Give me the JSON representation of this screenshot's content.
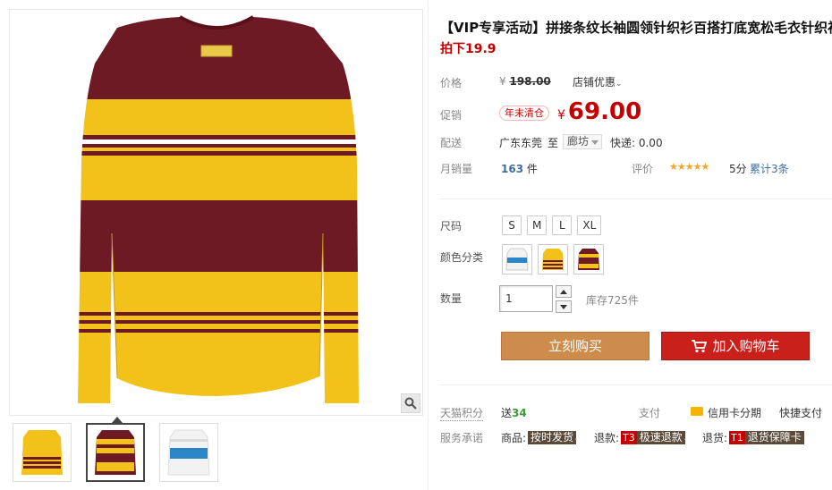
{
  "product": {
    "title": "【VIP专享活动】拼接条纹长袖圆领针织衫百搭打底宽松毛衣针织衫",
    "subtitle": "拍下19.9"
  },
  "price": {
    "label": "价格",
    "currency": "¥",
    "original": "198.00",
    "store_promo": "店铺优惠"
  },
  "promo": {
    "label": "促销",
    "badge": "年末清仓",
    "currency": "¥",
    "price": "69.00"
  },
  "shipping": {
    "label": "配送",
    "from": "广东东莞",
    "to_word": "至",
    "to_city": "廊坊",
    "fee": "快递: 0.00"
  },
  "sales": {
    "label": "月销量",
    "count": "163",
    "unit": "件",
    "rating_label": "评价",
    "stars": 5,
    "rating_score": "5分",
    "rating_count": "累计3条"
  },
  "options": {
    "size_label": "尺码",
    "sizes": [
      "S",
      "M",
      "L",
      "XL"
    ],
    "color_label": "颜色分类",
    "colors": [
      "white-blue",
      "yellow-maroon",
      "maroon-yellow"
    ]
  },
  "quantity": {
    "label": "数量",
    "value": "1",
    "stock": "库存725件"
  },
  "actions": {
    "buy": "立刻购买",
    "cart": "加入购物车"
  },
  "points": {
    "label": "天猫积分",
    "prefix": "送",
    "value": "34"
  },
  "payment": {
    "label": "支付",
    "credit": "信用卡分期",
    "quick": "快捷支付"
  },
  "services": {
    "label": "服务承诺",
    "goods_label": "商品:",
    "goods_tag": "按时发货",
    "refund_label": "退款:",
    "refund_t": "T3",
    "refund_tag": "极速退款",
    "return_label": "退货:",
    "return_t": "T1",
    "return_tag": "退货保障卡"
  },
  "colors": {
    "maroon": "#6e1a24",
    "yellow": "#f2c21b",
    "accent_red": "#c40000",
    "buy_btn": "#cd8c4b",
    "cart_btn": "#c9201c"
  }
}
